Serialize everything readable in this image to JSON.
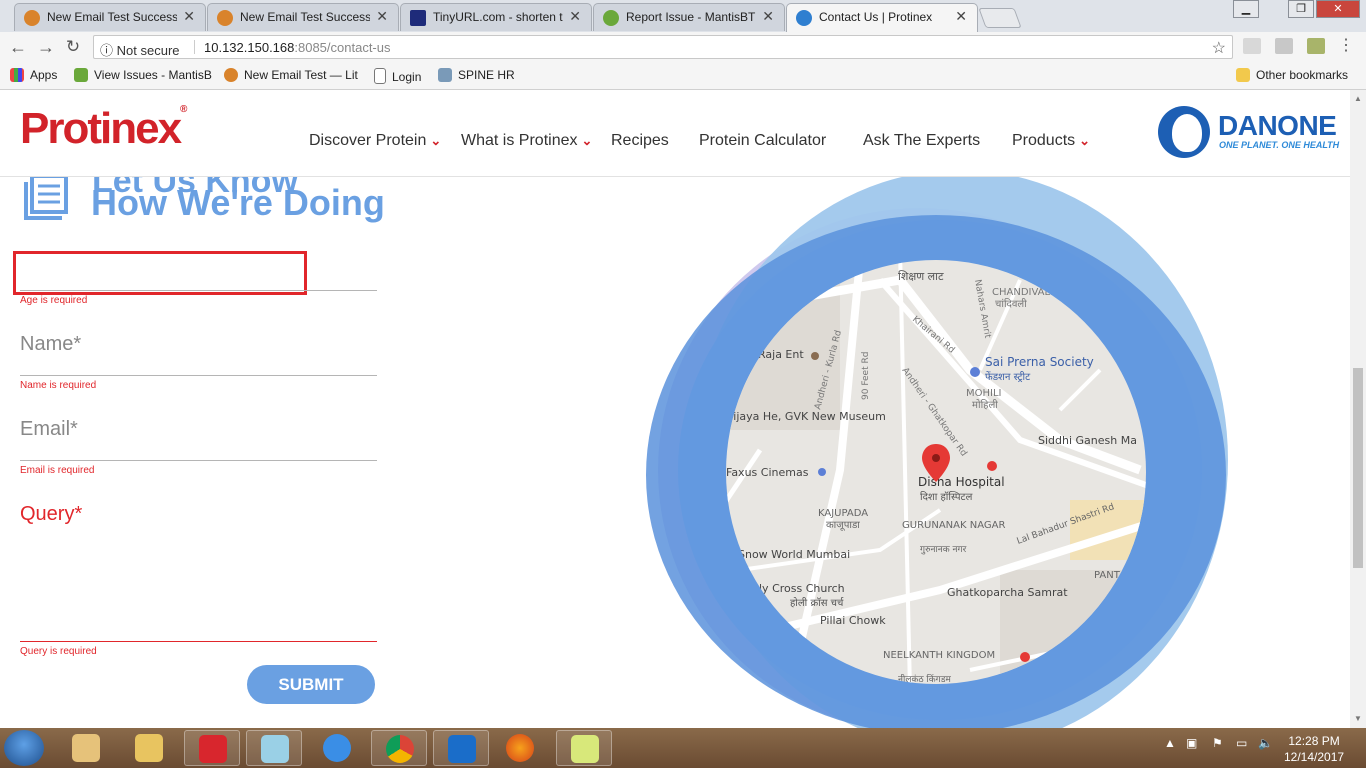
{
  "browser": {
    "tabs": [
      {
        "title": "New Email Test Success -",
        "favicon": "circle-logo-icon"
      },
      {
        "title": "New Email Test Success -",
        "favicon": "circle-logo-icon"
      },
      {
        "title": "TinyURL.com - shorten th",
        "favicon": "tinyurl-icon"
      },
      {
        "title": "Report Issue - MantisBT",
        "favicon": "mantis-icon"
      },
      {
        "title": "Contact Us | Protinex",
        "favicon": "drupal-icon"
      }
    ],
    "security": "Not secure",
    "url_host": "10.132.150.168",
    "url_rest": ":8085/contact-us",
    "bookmarks": [
      "Apps",
      "View Issues - MantisB",
      "New Email Test — Lit",
      "Login",
      "SPINE HR"
    ],
    "other_bookmarks": "Other bookmarks"
  },
  "site": {
    "logo": "Protinex",
    "nav": [
      "Discover Protein",
      "What is Protinex",
      "Recipes",
      "Protein Calculator",
      "Ask The Experts",
      "Products"
    ],
    "brand": "DANONE",
    "brand_tagline": "ONE PLANET. ONE HEALTH"
  },
  "form": {
    "heading_line1": "Let Us Know",
    "heading_line2": "How We're Doing",
    "age_error": "Age is required",
    "name_label": "Name*",
    "name_error": "Name is required",
    "email_label": "Email*",
    "email_error": "Email is required",
    "query_label": "Query*",
    "query_error": "Query is required",
    "submit": "SUBMIT"
  },
  "map": {
    "labels": [
      "शिक्षण लाट",
      "CHANDIVALI",
      "चांदिवली",
      "Khairani Rd",
      "Nahars Amrit",
      "Raja Ent",
      "Sai Prerna Society",
      "फेंडशन स्ट्रीट",
      "MOHILI",
      "मोहिली",
      "Andheri - Kurla Rd",
      "90 Feet Rd",
      "Andheri - Ghatkopar Rd",
      "Vijaya He, GVK New Museum",
      "Siddhi Ganesh Ma",
      "Disha Hospital",
      "दिशा हॉस्पिटल",
      "Faxus Cinemas",
      "KAJUPADA",
      "काजूपाडा",
      "GURUNANAK NAGAR",
      "गुरुनानक नगर",
      "Lal Bahadur Shastri Rd",
      "Snow World Mumbai",
      "Holy Cross Church",
      "होली क्रॉस चर्च",
      "Ghatkoparcha Samrat",
      "Pillai Chowk",
      "NEELKANTH KINGDOM",
      "नीलकंठ किंगडम",
      "PANT"
    ]
  },
  "taskbar": {
    "time": "12:28 PM",
    "date": "12/14/2017"
  },
  "colors": {
    "brand_red": "#d2232a",
    "heading_blue": "#6aa0e2",
    "error_red": "#e1262b",
    "danone_blue": "#1d5fb4"
  }
}
